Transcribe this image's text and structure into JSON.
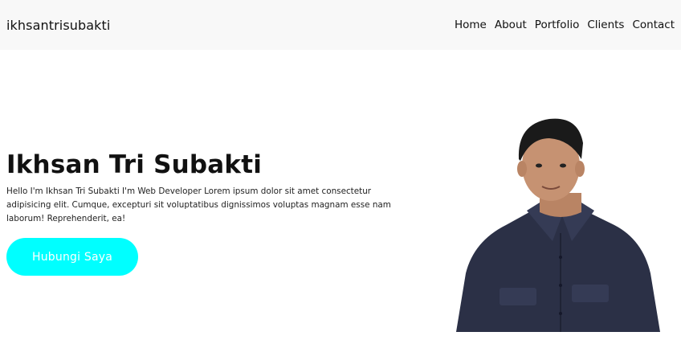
{
  "navbar": {
    "brand": "ikhsantrisubakti",
    "links": [
      "Home",
      "About",
      "Portfolio",
      "Clients",
      "Contact"
    ]
  },
  "hero": {
    "title": "Ikhsan Tri Subakti",
    "description": "Hello I'm Ikhsan Tri Subakti I'm Web Developer Lorem ipsum dolor sit amet consectetur adipisicing elit. Cumque, excepturi sit voluptatibus dignissimos voluptas magnam esse nam laborum! Reprehenderit, ea!",
    "cta_label": "Hubungi Saya"
  },
  "colors": {
    "navbar_bg": "#f8f8f8",
    "cta_bg": "#00ffff",
    "cta_text": "#ffffff",
    "shirt": "#2b3046"
  }
}
